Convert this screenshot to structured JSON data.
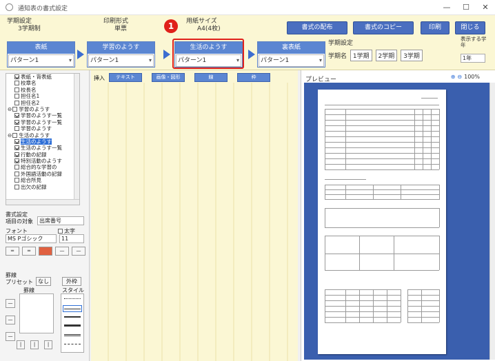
{
  "window": {
    "title": "通知表の書式設定",
    "controls": {
      "minimize": "—",
      "maximize": "☐",
      "close": "✕"
    }
  },
  "header": {
    "gakki_label": "学期設定",
    "gakki_value": "3学期制",
    "print_label": "印刷形式",
    "print_value": "単票",
    "paper_label": "用紙サイズ",
    "paper_value": "A4(4枚)",
    "buttons": {
      "haichi": "書式の配布",
      "copy": "書式のコピー",
      "print": "印刷",
      "close": "閉じる"
    },
    "grade_label": "学期設定",
    "grade_row_label": "学期名",
    "grades": [
      "1学期",
      "2学期",
      "3学期"
    ],
    "display_grade_label": "表示する学年",
    "display_grade_value": "1年"
  },
  "steps": [
    {
      "title": "表紙",
      "value": "パターン1"
    },
    {
      "title": "学習のようす",
      "value": "パターン1"
    },
    {
      "title": "生活のようす",
      "value": "パターン1"
    },
    {
      "title": "裏表紙",
      "value": "パターン1"
    }
  ],
  "callout_number": "1",
  "sidebar": {
    "tree": [
      {
        "label": "表紙・背表紙",
        "checked": true,
        "indent": 2
      },
      {
        "label": "校章名",
        "checked": false,
        "indent": 2
      },
      {
        "label": "校長名",
        "checked": false,
        "indent": 2
      },
      {
        "label": "担任名1",
        "checked": false,
        "indent": 2
      },
      {
        "label": "担任名2",
        "checked": false,
        "indent": 2
      },
      {
        "label": "学習のようす",
        "checked": false,
        "indent": 1,
        "expand": "⊖"
      },
      {
        "label": "学習のようす一覧",
        "checked": true,
        "indent": 2
      },
      {
        "label": "学習のようす一覧",
        "checked": true,
        "indent": 2
      },
      {
        "label": "学習のようす",
        "checked": false,
        "indent": 2
      },
      {
        "label": "生活のようす",
        "checked": false,
        "indent": 1,
        "expand": "⊖"
      },
      {
        "label": "生活のようす",
        "checked": true,
        "indent": 2,
        "selected": true
      },
      {
        "label": "生活のようす一覧",
        "checked": true,
        "indent": 2
      },
      {
        "label": "行動の記録",
        "checked": true,
        "indent": 2
      },
      {
        "label": "特別活動のようす",
        "checked": true,
        "indent": 2
      },
      {
        "label": "総合的な学習の",
        "checked": false,
        "indent": 2
      },
      {
        "label": "外国語活動の記録",
        "checked": false,
        "indent": 2
      },
      {
        "label": "総合所見",
        "checked": false,
        "indent": 2
      },
      {
        "label": "出欠の記録",
        "checked": false,
        "indent": 2
      }
    ],
    "format_label": "書式設定",
    "format_sublabel": "項目の対象",
    "format_value": "出席番号",
    "font_label": "フォント",
    "bold_label": "太字",
    "font_value": "MS Pゴシック",
    "size_value": "11",
    "border_label": "罫線",
    "preset_label": "プリセット",
    "preset_none": "なし",
    "preset_outer": "外枠",
    "lines_label": "罫線",
    "style_label": "スタイル"
  },
  "workarea": {
    "insert_label": "挿入",
    "buttons": [
      "テキスト",
      "画像・図形",
      "線",
      "枠"
    ]
  },
  "preview": {
    "title": "プレビュー",
    "zoom": "100%"
  }
}
